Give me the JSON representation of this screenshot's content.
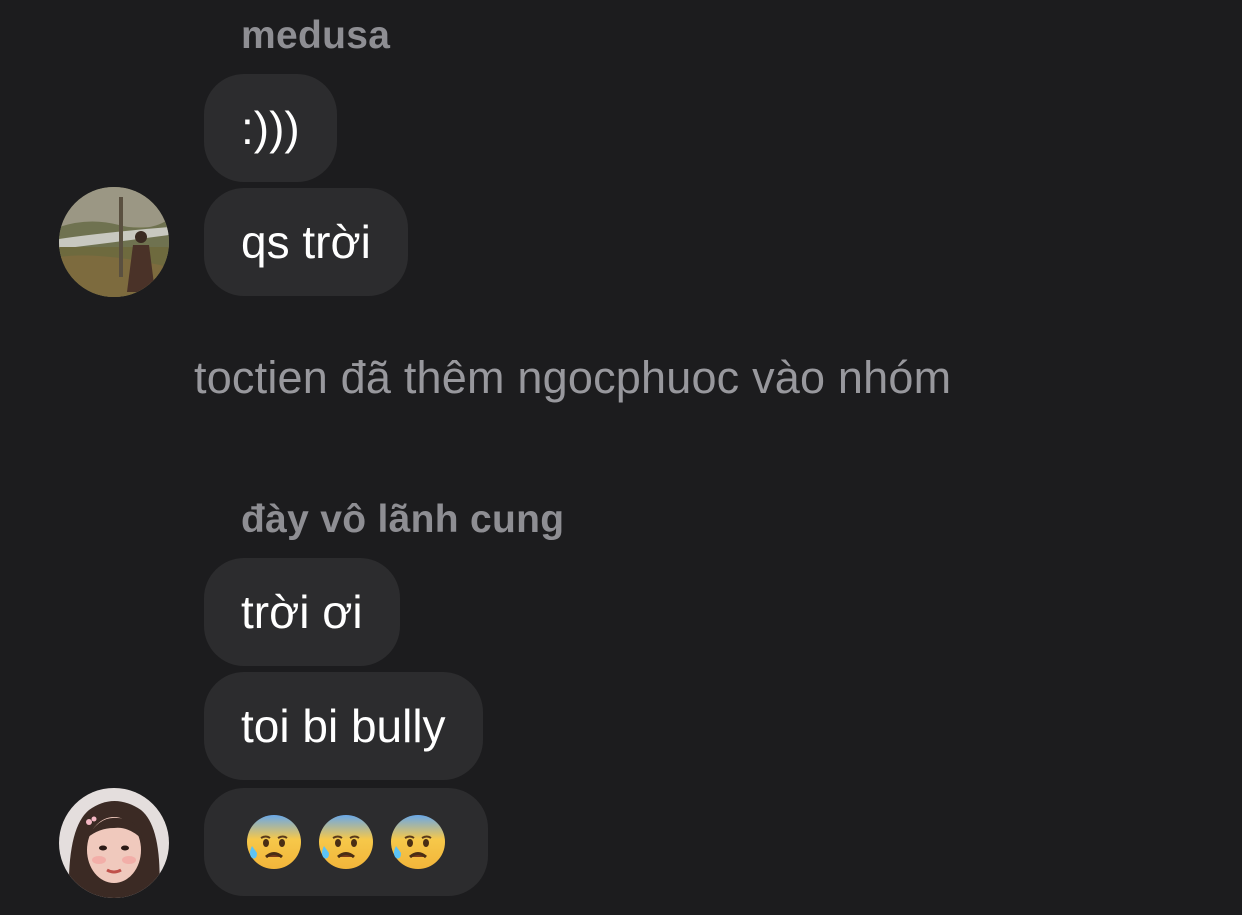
{
  "groups": [
    {
      "sender": "medusa",
      "messages": [
        ":)))",
        "qs trời"
      ]
    },
    {
      "sender": "đày vô lãnh cung",
      "messages": [
        "trời ơi",
        "toi bi bully"
      ],
      "emoji_message": [
        "anxious-face-with-sweat",
        "anxious-face-with-sweat",
        "anxious-face-with-sweat"
      ]
    }
  ],
  "system_message": "toctien đã thêm ngocphuoc vào nhóm",
  "colors": {
    "background": "#1c1c1e",
    "bubble": "#2c2c2e",
    "sender_name": "#8e8e93",
    "system_text": "#98989d",
    "message_text": "#ffffff"
  }
}
